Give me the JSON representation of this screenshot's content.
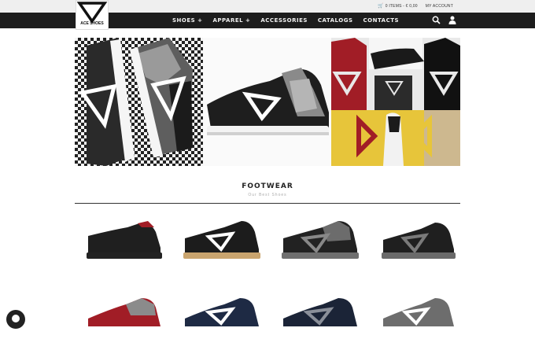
{
  "header": {
    "cart_text": "0 ITEMS - € 0,00",
    "account_text": "MY ACCOUNT",
    "logo_text": "ACE SHOES"
  },
  "nav": {
    "items": [
      {
        "label": "SHOES +"
      },
      {
        "label": "APPAREL +"
      },
      {
        "label": "ACCESSORIES"
      },
      {
        "label": "CATALOGS"
      },
      {
        "label": "CONTACTS"
      }
    ]
  },
  "section": {
    "title": "FOOTWEAR",
    "subtitle": "Our Best Shoes"
  },
  "colors": {
    "topbar_bg": "#efefef",
    "navbar_bg": "#1d1d1d",
    "accent_red": "#a11d26",
    "accent_yellow": "#e7c53a"
  },
  "icons": {
    "search": "search-icon",
    "user": "user-icon",
    "cart": "cart-icon"
  },
  "products": [
    {
      "name": "black-red-sneaker"
    },
    {
      "name": "black-gum-sneaker"
    },
    {
      "name": "black-camo-sneaker"
    },
    {
      "name": "black-grey-sneaker"
    },
    {
      "name": "red-grey-sneaker"
    },
    {
      "name": "navy-sneaker"
    },
    {
      "name": "navy-grey-sneaker"
    },
    {
      "name": "grey-sneaker"
    }
  ]
}
